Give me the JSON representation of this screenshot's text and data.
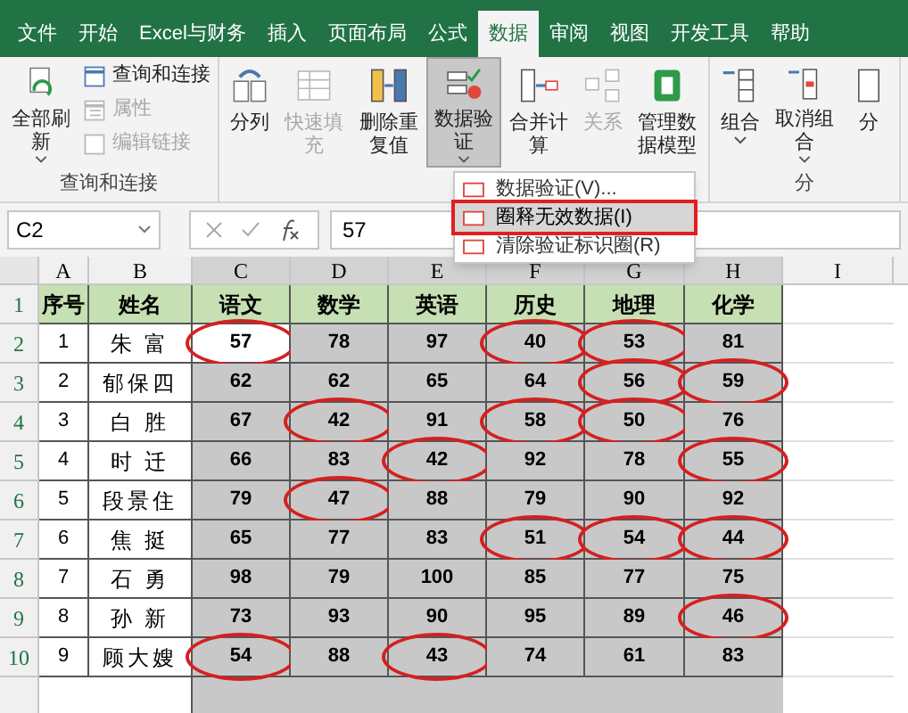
{
  "tabs": [
    {
      "label": "文件",
      "selected": false
    },
    {
      "label": "开始",
      "selected": false
    },
    {
      "label": "Excel与财务",
      "selected": false
    },
    {
      "label": "插入",
      "selected": false
    },
    {
      "label": "页面布局",
      "selected": false
    },
    {
      "label": "公式",
      "selected": false
    },
    {
      "label": "数据",
      "selected": true
    },
    {
      "label": "审阅",
      "selected": false
    },
    {
      "label": "视图",
      "selected": false
    },
    {
      "label": "开发工具",
      "selected": false
    },
    {
      "label": "帮助",
      "selected": false
    }
  ],
  "ribbon": {
    "groups": [
      {
        "label": "查询和连接",
        "items": [
          {
            "kind": "large",
            "label": "全部刷新",
            "disabled": false,
            "pressed": false,
            "dropdown": true
          },
          {
            "kind": "small",
            "label": "查询和连接",
            "disabled": false
          },
          {
            "kind": "small",
            "label": "属性",
            "disabled": true
          },
          {
            "kind": "small",
            "label": "编辑链接",
            "disabled": true
          }
        ]
      },
      {
        "items": [
          {
            "kind": "large",
            "label": "分列",
            "disabled": false,
            "pressed": false,
            "dropdown": false
          },
          {
            "kind": "large",
            "label": "快速填充",
            "disabled": true,
            "pressed": false,
            "dropdown": false
          },
          {
            "kind": "large",
            "label": "删除重复值",
            "disabled": false,
            "pressed": false,
            "dropdown": false
          },
          {
            "kind": "large",
            "label": "数据验证",
            "disabled": false,
            "pressed": true,
            "dropdown": true
          },
          {
            "kind": "large",
            "label": "合并计算",
            "disabled": false,
            "pressed": false,
            "dropdown": false
          },
          {
            "kind": "large",
            "label": "关系",
            "disabled": true,
            "pressed": false,
            "dropdown": false
          },
          {
            "kind": "large",
            "label": "管理数据模型",
            "disabled": false,
            "pressed": false,
            "dropdown": false
          }
        ]
      },
      {
        "label": "分",
        "items": [
          {
            "kind": "large",
            "label": "组合",
            "disabled": false,
            "pressed": false,
            "dropdown": true
          },
          {
            "kind": "large",
            "label": "取消组合",
            "disabled": false,
            "pressed": false,
            "dropdown": true
          },
          {
            "kind": "large",
            "label": "分",
            "disabled": false,
            "pressed": false,
            "dropdown": false
          }
        ]
      }
    ]
  },
  "menu": [
    {
      "label": "数据验证(V)...",
      "highlighted": false
    },
    {
      "label": "圈释无效数据(I)",
      "highlighted": true
    },
    {
      "label": "清除验证标识圈(R)",
      "highlighted": false
    }
  ],
  "formula_bar": {
    "name_box": "C2",
    "value": "57"
  },
  "sheet": {
    "columns": [
      "A",
      "B",
      "C",
      "D",
      "E",
      "F",
      "G",
      "H",
      "I"
    ],
    "row_numbers": [
      "1",
      "2",
      "3",
      "4",
      "5",
      "6",
      "7",
      "8",
      "9",
      "10"
    ],
    "header_row": [
      "序号",
      "姓名",
      "语文",
      "数学",
      "英语",
      "历史",
      "地理",
      "化学"
    ],
    "rows": [
      {
        "no": "1",
        "name": "朱 富",
        "scores": [
          {
            "v": "57",
            "flagged": true,
            "selected": true
          },
          {
            "v": "78",
            "flagged": false,
            "selected": false
          },
          {
            "v": "97",
            "flagged": false,
            "selected": false
          },
          {
            "v": "40",
            "flagged": true,
            "selected": false
          },
          {
            "v": "53",
            "flagged": true,
            "selected": false
          },
          {
            "v": "81",
            "flagged": false,
            "selected": false
          }
        ]
      },
      {
        "no": "2",
        "name": "郁保四",
        "scores": [
          {
            "v": "62",
            "flagged": false,
            "selected": false
          },
          {
            "v": "62",
            "flagged": false,
            "selected": false
          },
          {
            "v": "65",
            "flagged": false,
            "selected": false
          },
          {
            "v": "64",
            "flagged": false,
            "selected": false
          },
          {
            "v": "56",
            "flagged": true,
            "selected": false
          },
          {
            "v": "59",
            "flagged": true,
            "selected": false
          }
        ]
      },
      {
        "no": "3",
        "name": "白 胜",
        "scores": [
          {
            "v": "67",
            "flagged": false,
            "selected": false
          },
          {
            "v": "42",
            "flagged": true,
            "selected": false
          },
          {
            "v": "91",
            "flagged": false,
            "selected": false
          },
          {
            "v": "58",
            "flagged": true,
            "selected": false
          },
          {
            "v": "50",
            "flagged": true,
            "selected": false
          },
          {
            "v": "76",
            "flagged": false,
            "selected": false
          }
        ]
      },
      {
        "no": "4",
        "name": "时 迁",
        "scores": [
          {
            "v": "66",
            "flagged": false,
            "selected": false
          },
          {
            "v": "83",
            "flagged": false,
            "selected": false
          },
          {
            "v": "42",
            "flagged": true,
            "selected": false
          },
          {
            "v": "92",
            "flagged": false,
            "selected": false
          },
          {
            "v": "78",
            "flagged": false,
            "selected": false
          },
          {
            "v": "55",
            "flagged": true,
            "selected": false
          }
        ]
      },
      {
        "no": "5",
        "name": "段景住",
        "scores": [
          {
            "v": "79",
            "flagged": false,
            "selected": false
          },
          {
            "v": "47",
            "flagged": true,
            "selected": false
          },
          {
            "v": "88",
            "flagged": false,
            "selected": false
          },
          {
            "v": "79",
            "flagged": false,
            "selected": false
          },
          {
            "v": "90",
            "flagged": false,
            "selected": false
          },
          {
            "v": "92",
            "flagged": false,
            "selected": false
          }
        ]
      },
      {
        "no": "6",
        "name": "焦 挺",
        "scores": [
          {
            "v": "65",
            "flagged": false,
            "selected": false
          },
          {
            "v": "77",
            "flagged": false,
            "selected": false
          },
          {
            "v": "83",
            "flagged": false,
            "selected": false
          },
          {
            "v": "51",
            "flagged": true,
            "selected": false
          },
          {
            "v": "54",
            "flagged": true,
            "selected": false
          },
          {
            "v": "44",
            "flagged": true,
            "selected": false
          }
        ]
      },
      {
        "no": "7",
        "name": "石 勇",
        "scores": [
          {
            "v": "98",
            "flagged": false,
            "selected": false
          },
          {
            "v": "79",
            "flagged": false,
            "selected": false
          },
          {
            "v": "100",
            "flagged": false,
            "selected": false
          },
          {
            "v": "85",
            "flagged": false,
            "selected": false
          },
          {
            "v": "77",
            "flagged": false,
            "selected": false
          },
          {
            "v": "75",
            "flagged": false,
            "selected": false
          }
        ]
      },
      {
        "no": "8",
        "name": "孙 新",
        "scores": [
          {
            "v": "73",
            "flagged": false,
            "selected": false
          },
          {
            "v": "93",
            "flagged": false,
            "selected": false
          },
          {
            "v": "90",
            "flagged": false,
            "selected": false
          },
          {
            "v": "95",
            "flagged": false,
            "selected": false
          },
          {
            "v": "89",
            "flagged": false,
            "selected": false
          },
          {
            "v": "46",
            "flagged": true,
            "selected": false
          }
        ]
      },
      {
        "no": "9",
        "name": "顾大嫂",
        "scores": [
          {
            "v": "54",
            "flagged": true,
            "selected": false
          },
          {
            "v": "88",
            "flagged": false,
            "selected": false
          },
          {
            "v": "43",
            "flagged": true,
            "selected": false
          },
          {
            "v": "74",
            "flagged": false,
            "selected": false
          },
          {
            "v": "61",
            "flagged": false,
            "selected": false
          },
          {
            "v": "83",
            "flagged": false,
            "selected": false
          }
        ]
      }
    ]
  }
}
